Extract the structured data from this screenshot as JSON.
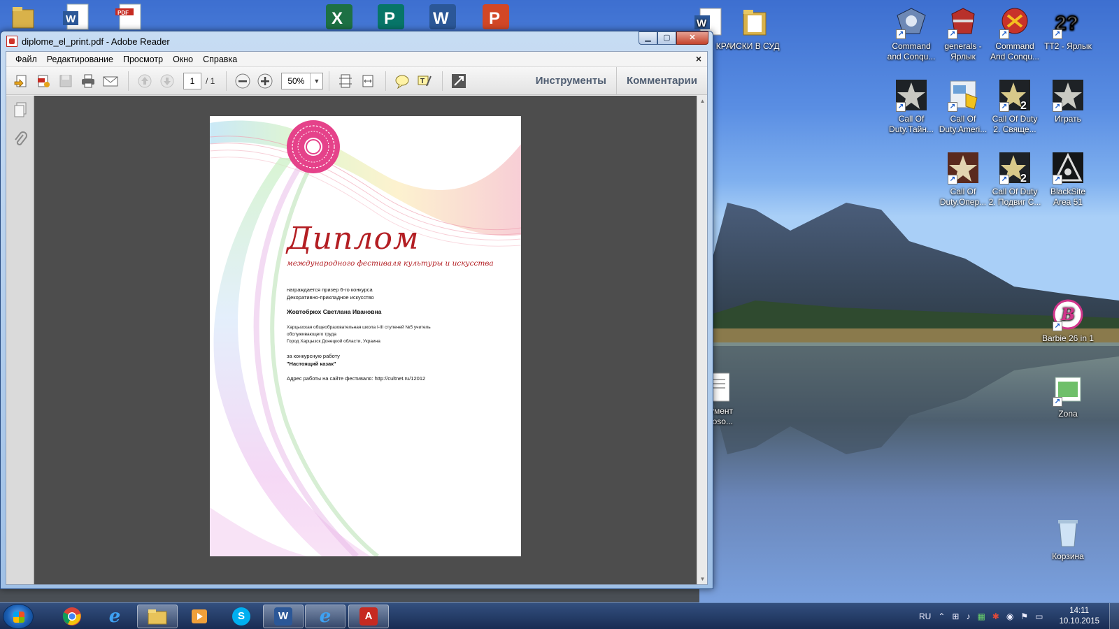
{
  "window": {
    "title": "diplome_el_print.pdf - Adobe Reader",
    "close_glyph": "✕",
    "min_glyph": "▁",
    "max_glyph": "▢"
  },
  "menu": [
    "Файл",
    "Редактирование",
    "Просмотр",
    "Окно",
    "Справка"
  ],
  "menu_close": "×",
  "toolbar": {
    "page_current": "1",
    "page_total": "/ 1",
    "zoom": "50%",
    "tools_label": "Инструменты",
    "comments_label": "Комментарии"
  },
  "document": {
    "title": "Диплом",
    "subtitle": "международного фестиваля культуры и искусства",
    "line1": "награждается призер 6-го конкурса",
    "line2": "Декоративно-прикладное искусство",
    "name": "Жовтобрюх Светлана Ивановна",
    "org1": "Харцызская общеобразовательная школа I-III ступеней №5 учитель",
    "org2": "обслуживающего труда",
    "org3": "Город Харцызск Донецкой области, Украина",
    "work_label": "за конкурсную работу",
    "work_title": "\"Настоящий казак\"",
    "url_line": "Адрес работы на сайте фестиваля: http://cultnet.ru/12012"
  },
  "desktop_icons": {
    "partial_krai": "КРА",
    "iski": "ИСКИ В СУД",
    "cc1_a": "Command",
    "cc1_b": "and Conqu...",
    "generals_a": "generals -",
    "generals_b": "Ярлык",
    "cc2_a": "Command",
    "cc2_b": "And Conqu...",
    "tt2": "TT2 - Ярлык",
    "cod1_a": "Call Of",
    "cod1_b": "Duty.Тайн...",
    "cod2_a": "Call Of",
    "cod2_b": "Duty.Ameri...",
    "cod3_a": "Call Of Duty",
    "cod3_b": "2. Свяще...",
    "play": "Играть",
    "cod4_a": "Call Of",
    "cod4_b": "Duty.Опер...",
    "cod5_a": "Call Of Duty",
    "cod5_b": "2. Подвиг С...",
    "blacksite_a": "BlackSite",
    "blacksite_b": "Area 51",
    "partial_doc_a": "умент",
    "partial_doc_b": "roso...",
    "barbie": "Barbie 26 in 1",
    "zona": "Zona",
    "recycle": "Корзина"
  },
  "taskbar": {
    "lang": "RU",
    "time": "14:11",
    "date": "10.10.2015"
  },
  "colors": {
    "diploma_red": "#b31e23",
    "reader_gray": "#4d4d4d",
    "pink_rosette": "#e5428a"
  }
}
